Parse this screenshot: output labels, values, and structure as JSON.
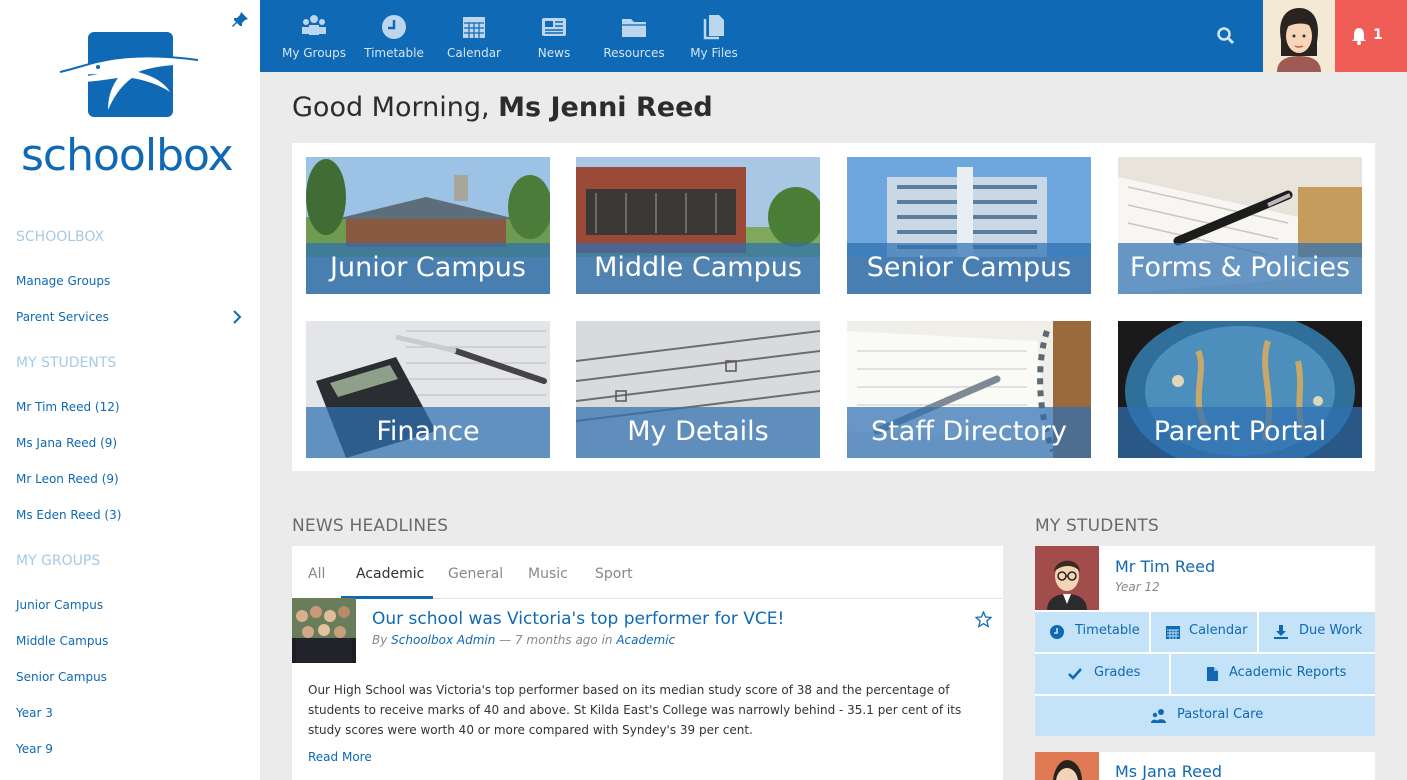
{
  "brand": {
    "name": "schoolbox"
  },
  "sidebar": {
    "sections": [
      {
        "heading": "SCHOOLBOX",
        "items": [
          "Manage Groups",
          "Parent Services"
        ]
      },
      {
        "heading": "MY STUDENTS",
        "items": [
          "Mr Tim Reed (12)",
          "Ms Jana Reed (9)",
          "Mr Leon Reed (9)",
          "Ms Eden Reed (3)"
        ]
      },
      {
        "heading": "MY GROUPS",
        "items": [
          "Junior Campus",
          "Middle Campus",
          "Senior Campus",
          "Year 3",
          "Year 9"
        ]
      }
    ]
  },
  "topnav": {
    "items": [
      {
        "label": "My Groups",
        "icon": "groups-icon"
      },
      {
        "label": "Timetable",
        "icon": "clock-icon"
      },
      {
        "label": "Calendar",
        "icon": "calendar-icon"
      },
      {
        "label": "News",
        "icon": "news-icon"
      },
      {
        "label": "Resources",
        "icon": "folder-icon"
      },
      {
        "label": "My Files",
        "icon": "files-icon"
      }
    ],
    "notification_count": "1",
    "colors": {
      "bar": "#0f69b4",
      "notification": "#f05d57"
    }
  },
  "greeting": {
    "prefix": "Good Morning,",
    "name": "Ms Jenni Reed"
  },
  "tiles": [
    "Junior Campus",
    "Middle Campus",
    "Senior Campus",
    "Forms & Policies",
    "Finance",
    "My Details",
    "Staff Directory",
    "Parent Portal"
  ],
  "news": {
    "heading": "NEWS HEADLINES",
    "tabs": [
      "All",
      "Academic",
      "General",
      "Music",
      "Sport"
    ],
    "active_tab": "Academic",
    "article": {
      "title": "Our school was Victoria's top performer for VCE!",
      "by": "By",
      "author": "Schoolbox Admin",
      "when": "— 7 months ago in",
      "category": "Academic",
      "body": "Our High School was Victoria's top performer based on its median study score of 38 and the percentage of students to receive marks of 40 and above. St Kilda East's College was narrowly behind - 35.1 per cent of its study scores were worth 40 or more compared with Syndey's 39 per cent.",
      "read_more": "Read More"
    }
  },
  "students": {
    "heading": "MY STUDENTS",
    "list": [
      {
        "name": "Mr Tim Reed",
        "year": "Year 12"
      },
      {
        "name": "Ms Jana Reed"
      }
    ],
    "buttons": [
      "Timetable",
      "Calendar",
      "Due Work",
      "Grades",
      "Academic Reports",
      "Pastoral Care"
    ]
  }
}
